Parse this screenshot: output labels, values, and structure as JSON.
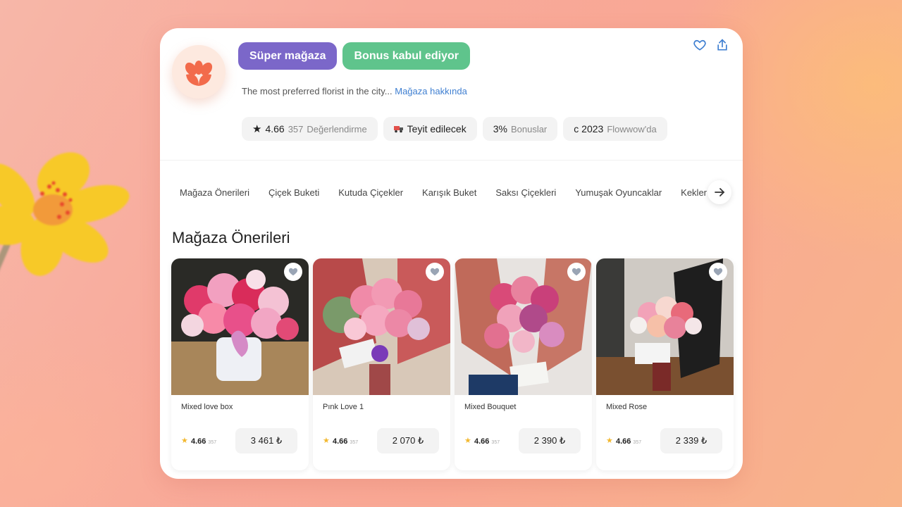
{
  "store": {
    "badges": [
      "Süper mağaza",
      "Bonus kabul ediyor"
    ],
    "description": "The most preferred florist in the city...",
    "about_link": "Mağaza hakkında",
    "brand_color": "#f26b4b"
  },
  "stats": {
    "rating": "4.66",
    "rating_count": "357",
    "rating_label": "Değerlendirme",
    "verify": "Teyit edilecek",
    "bonus_value": "3%",
    "bonus_label": "Bonuslar",
    "since_value": "c 2023",
    "since_label": "Flowwow'da"
  },
  "icons": {
    "favorite": "heart-icon",
    "share": "share-icon",
    "rating": "star-icon",
    "verify": "truck-icon",
    "next": "arrow-right-icon"
  },
  "tabs": [
    "Mağaza Önerileri",
    "Çiçek Buketi",
    "Kutuda Çiçekler",
    "Karışık Buket",
    "Saksı Çiçekleri",
    "Yumuşak Oyuncaklar",
    "Kekler"
  ],
  "section_title": "Mağaza Önerileri",
  "products": [
    {
      "name": "Mixed love box",
      "rating": "4.66",
      "count": "357",
      "price": "3 461 ₺"
    },
    {
      "name": "Pınk Love 1",
      "rating": "4.66",
      "count": "357",
      "price": "2 070 ₺"
    },
    {
      "name": "Mixed Bouquet",
      "rating": "4.66",
      "count": "357",
      "price": "2 390 ₺"
    },
    {
      "name": "Mixed Rose",
      "rating": "4.66",
      "count": "357",
      "price": "2 339 ₺"
    }
  ]
}
